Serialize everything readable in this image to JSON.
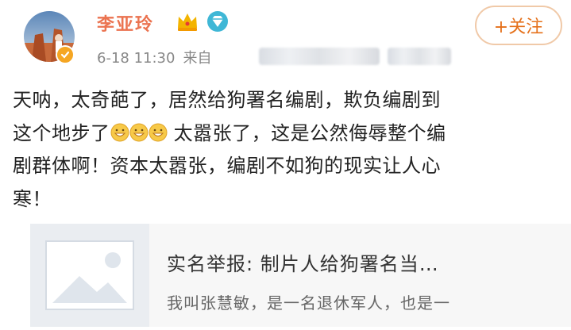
{
  "header": {
    "username": "李亚玲",
    "timestamp": "6-18 11:30",
    "source_prefix": "来自",
    "follow_label": "+关注"
  },
  "icons": {
    "avatar": "avatar",
    "verified": "verified-badge-icon",
    "crown": "crown-icon",
    "vip": "vip-diamond-icon"
  },
  "post": {
    "line1": "天呐，太奇葩了，居然给狗署名编剧，欺负编剧到",
    "line2_a": "这个地步了",
    "line2_b": " 太嚣张了，这是公然侮辱整个编",
    "line3": "剧群体啊！资本太嚣张，编剧不如狗的现实让人心",
    "line4": "寒！"
  },
  "card": {
    "title": "实名举报: 制片人给狗署名当…",
    "description": "我叫张慧敏，是一名退休军人，也是一"
  },
  "colors": {
    "username": "#eb7350",
    "follow": "#e5701a",
    "badge": "#f5a623",
    "vip": "#3fb7d6"
  }
}
